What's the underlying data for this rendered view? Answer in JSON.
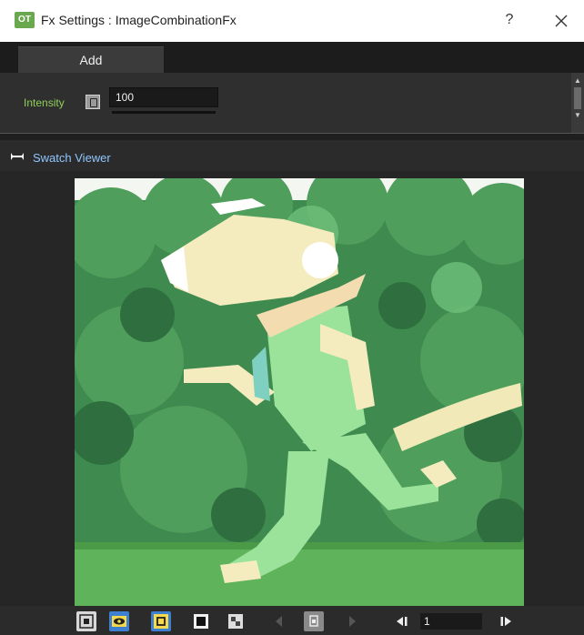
{
  "window": {
    "app_badge": "OT",
    "title": "Fx Settings : ImageCombinationFx",
    "help_label": "?",
    "close_label": "✕"
  },
  "tabs": [
    {
      "label": "Add",
      "selected": true
    }
  ],
  "params": {
    "intensity": {
      "label": "Intensity",
      "value": "100"
    }
  },
  "swatch": {
    "title": "Swatch Viewer",
    "image_description_icon": "image-preview"
  },
  "toolbar": {
    "frame_value": "1",
    "buttons": [
      "camera-stand-toggle-icon",
      "preview-toggle-icon",
      "sub-camera-preview-icon",
      "black-background-icon",
      "checkerboard-background-icon",
      "previous-key-icon",
      "keyframe-icon",
      "next-key-icon",
      "first-frame-icon",
      "last-frame-icon"
    ]
  },
  "colors": {
    "accent_green": "#8fcf5a",
    "accent_blue": "#8fc6ff",
    "active_button": "#3d7fd0"
  }
}
